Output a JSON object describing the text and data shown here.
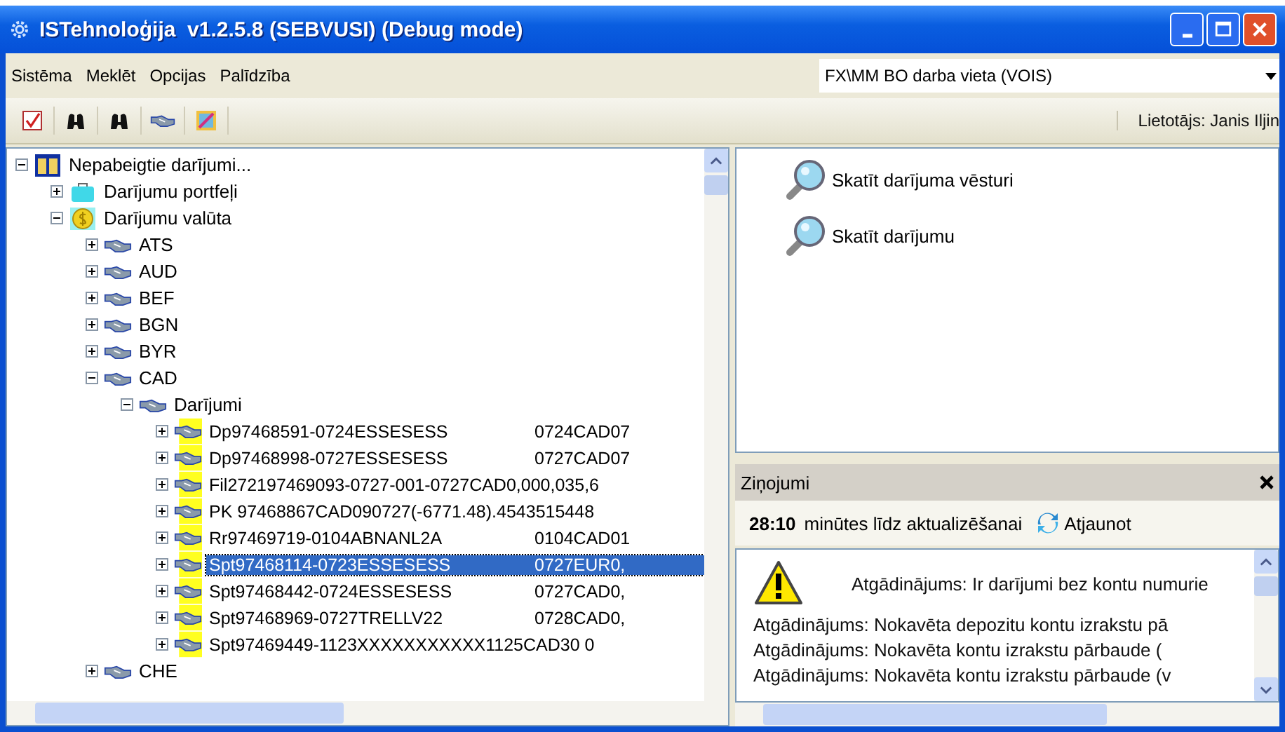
{
  "window": {
    "title": "ISTehnoloģija  v1.2.5.8 (SEBVUSI) (Debug mode)"
  },
  "menu": [
    {
      "label": "Sistēma"
    },
    {
      "label": "Meklēt"
    },
    {
      "label": "Opcijas"
    },
    {
      "label": "Palīdzība"
    }
  ],
  "workplace": {
    "value": "FX\\MM BO darba vieta (VOIS)"
  },
  "toolbar": [
    {
      "kind": "check"
    },
    {
      "kind": "binoculars"
    },
    {
      "kind": "binoculars"
    },
    {
      "kind": "handshake"
    },
    {
      "kind": "calendar"
    }
  ],
  "user": "Lietotājs: Janis Iljin",
  "tree": [
    {
      "label": "Nepabeigtie darījumi...",
      "kind": "root",
      "expanded": true,
      "selected": false,
      "children": [
        {
          "label": "Darījumu portfeļi",
          "kind": "portfolio",
          "expanded": false,
          "selected": false
        },
        {
          "label": "Darījumu valūta",
          "kind": "currency",
          "expanded": true,
          "selected": false,
          "children": [
            {
              "label": "ATS",
              "kind": "group",
              "expanded": false,
              "selected": false
            },
            {
              "label": "AUD",
              "kind": "group",
              "expanded": false,
              "selected": false
            },
            {
              "label": "BEF",
              "kind": "group",
              "expanded": false,
              "selected": false
            },
            {
              "label": "BGN",
              "kind": "group",
              "expanded": false,
              "selected": false
            },
            {
              "label": "BYR",
              "kind": "group",
              "expanded": false,
              "selected": false
            },
            {
              "label": "CAD",
              "kind": "group",
              "expanded": true,
              "selected": false,
              "children": [
                {
                  "label": "Darījumi",
                  "kind": "group",
                  "expanded": true,
                  "selected": false,
                  "children": [
                    {
                      "label": "Dp97468591-0724ESSESESS",
                      "code": "0724CAD07",
                      "kind": "deal",
                      "expanded": false,
                      "selected": false
                    },
                    {
                      "label": "Dp97468998-0727ESSESESS",
                      "code": "0727CAD07",
                      "kind": "deal",
                      "expanded": false,
                      "selected": false
                    },
                    {
                      "label": "Fil272197469093-0727-001-0727CAD0,000,035,6",
                      "kind": "deal",
                      "expanded": false,
                      "selected": false
                    },
                    {
                      "label": "PK  97468867CAD090727(-6771.48).4543515448",
                      "kind": "deal",
                      "expanded": false,
                      "selected": false
                    },
                    {
                      "label": "Rr97469719-0104ABNANL2A",
                      "code": "0104CAD01",
                      "kind": "deal",
                      "expanded": false,
                      "selected": false
                    },
                    {
                      "label": "Spt97468114-0723ESSESESS",
                      "code": "0727EUR0,",
                      "kind": "deal",
                      "expanded": false,
                      "selected": true
                    },
                    {
                      "label": "Spt97468442-0724ESSESESS",
                      "code": "0727CAD0,",
                      "kind": "deal",
                      "expanded": false,
                      "selected": false
                    },
                    {
                      "label": "Spt97468969-0727TRELLV22",
                      "code": "0728CAD0,",
                      "kind": "deal",
                      "expanded": false,
                      "selected": false
                    },
                    {
                      "label": "Spt97469449-1123XXXXXXXXXXX1125CAD30 0",
                      "kind": "deal",
                      "expanded": false,
                      "selected": false
                    }
                  ]
                }
              ]
            },
            {
              "label": "CHE",
              "kind": "group",
              "expanded": false,
              "selected": false
            }
          ]
        }
      ]
    }
  ],
  "actions": [
    {
      "label": "Skatīt darījuma vēsturi"
    },
    {
      "label": "Skatīt darījumu"
    }
  ],
  "messages": {
    "title": "Ziņojumi",
    "timer": "28:10",
    "timer_label": "minūtes līdz aktualizēšanai",
    "refresh": "Atjaunot",
    "items": [
      {
        "kind": "warning",
        "text": "Atgādinājums: Ir darījumi bez kontu numurie"
      },
      {
        "kind": "plain",
        "text": "Atgādinājums: Nokavēta depozitu kontu izrakstu pā"
      },
      {
        "kind": "plain",
        "text": "Atgādinājums: Nokavēta kontu izrakstu pārbaude ("
      },
      {
        "kind": "plain",
        "text": "Atgādinājums: Nokavēta kontu izrakstu pārbaude (v"
      }
    ]
  }
}
